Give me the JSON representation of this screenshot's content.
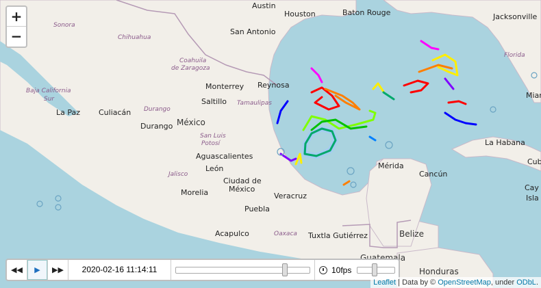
{
  "map": {
    "water_color": "#aad3df",
    "land_color": "#f2efe9",
    "zoom_in_label": "+",
    "zoom_out_label": "−",
    "cities": [
      "Austin",
      "Houston",
      "Baton Rouge",
      "Jacksonville",
      "San Antonio",
      "Monterrey",
      "Reynosa",
      "Saltillo",
      "La Paz",
      "Culiacán",
      "Durango",
      "Aguascalientes",
      "León",
      "Ciudad de México",
      "Morelia",
      "Puebla",
      "Veracruz",
      "Acapulco",
      "Tuxtla Gutiérrez",
      "Mérida",
      "Cancún",
      "La Habana",
      "Miami",
      "Guatemala",
      "Honduras"
    ],
    "states": [
      "Sonora",
      "Chihuahua",
      "Coahuila de Zaragoza",
      "Baja California Sur",
      "Durango",
      "Tamaulipas",
      "San Luis Potosí",
      "Jalisco",
      "Oaxaca",
      "Florida"
    ],
    "countries": [
      "México",
      "Belize",
      "Cuba",
      "Cayman Islands"
    ],
    "labels": {
      "austin": "Austin",
      "houston": "Houston",
      "baton_rouge": "Baton Rouge",
      "jacksonville": "Jacksonville",
      "sonora": "Sonora",
      "chihuahua": "Chihuahua",
      "san_antonio": "San Antonio",
      "florida": "Florida",
      "coahuila_1": "Coahuila",
      "coahuila_2": "de Zaragoza",
      "monterrey": "Monterrey",
      "reynosa": "Reynosa",
      "miami": "Miam",
      "baja_1": "Baja California",
      "baja_2": "Sur",
      "saltillo": "Saltillo",
      "tamaulipas": "Tamaulipas",
      "la_paz": "La Paz",
      "culiacan": "Culiacán",
      "durango_state": "Durango",
      "mexico": "México",
      "durango": "Durango",
      "slp_1": "San Luis",
      "slp_2": "Potosí",
      "la_habana": "La Habana",
      "cuba": "Cub",
      "aguascalientes": "Aguascalientes",
      "merida": "Mérida",
      "leon": "León",
      "cancun": "Cancún",
      "jalisco": "Jalisco",
      "cdmx_1": "Ciudad de",
      "cdmx_2": "México",
      "cayman_1": "Cay",
      "cayman_2": "Isla",
      "morelia": "Morelia",
      "veracruz": "Veracruz",
      "puebla": "Puebla",
      "acapulco": "Acapulco",
      "oaxaca": "Oaxaca",
      "tuxtla": "Tuxtla Gutiérrez",
      "belize": "Belize",
      "guatemala": "Guatemala",
      "guatemala_2": "Guatemal",
      "honduras": "Honduras"
    }
  },
  "tracks": {
    "colors": [
      "#ff0000",
      "#ff7f00",
      "#ffee00",
      "#7fff00",
      "#00c000",
      "#00a86b",
      "#0080ff",
      "#0000ff",
      "#7f00ff",
      "#ff00ff",
      "#a0c8ff"
    ]
  },
  "timeline": {
    "back_label": "◀◀",
    "play_label": "▶",
    "forward_label": "▶▶",
    "current_time": "2020-02-16 11:14:11",
    "progress": 0.82,
    "fps_label": "10fps",
    "fps_slider": 0.45
  },
  "attribution": {
    "leaflet": "Leaflet",
    "sep1": " | Data by © ",
    "osm": "OpenStreetMap",
    "sep2": ", under ",
    "odbl": "ODbL",
    "end": "."
  }
}
